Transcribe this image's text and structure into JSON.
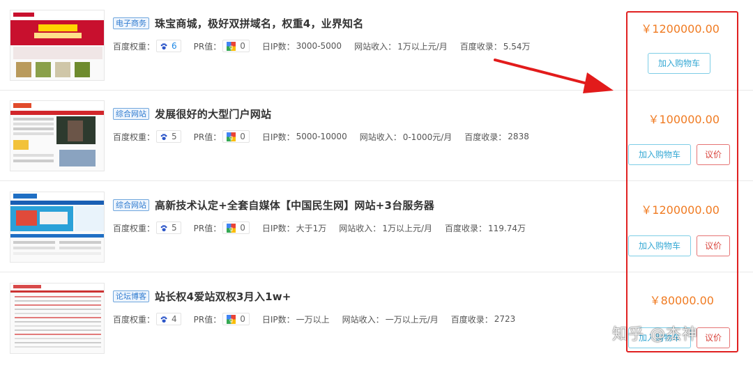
{
  "listings": [
    {
      "category": "电子商务",
      "title": "珠宝商城，极好双拼域名，权重4，业界知名",
      "baidu_weight_label": "百度权重：",
      "baidu_weight": "6",
      "pr_label": "PR值：",
      "pr": "0",
      "ip_label": "日IP数：",
      "ip": "3000-5000",
      "income_label": "网站收入：",
      "income": "1万以上元/月",
      "index_label": "百度收录：",
      "index": "5.54万",
      "price": "￥1200000.00",
      "cart_label": "加入购物车",
      "negotiate_label": ""
    },
    {
      "category": "综合网站",
      "title": "发展很好的大型门户网站",
      "baidu_weight_label": "百度权重：",
      "baidu_weight": "5",
      "pr_label": "PR值：",
      "pr": "0",
      "ip_label": "日IP数：",
      "ip": "5000-10000",
      "income_label": "网站收入：",
      "income": "0-1000元/月",
      "index_label": "百度收录：",
      "index": "2838",
      "price": "￥100000.00",
      "cart_label": "加入购物车",
      "negotiate_label": "议价"
    },
    {
      "category": "综合网站",
      "title": "高新技术认定+全套自媒体【中国民生网】网站+3台服务器",
      "baidu_weight_label": "百度权重：",
      "baidu_weight": "5",
      "pr_label": "PR值：",
      "pr": "0",
      "ip_label": "日IP数：",
      "ip": "大于1万",
      "income_label": "网站收入：",
      "income": "1万以上元/月",
      "index_label": "百度收录：",
      "index": "119.74万",
      "price": "￥1200000.00",
      "cart_label": "加入购物车",
      "negotiate_label": "议价"
    },
    {
      "category": "论坛博客",
      "title": "站长权4爱站双权3月入1w+",
      "baidu_weight_label": "百度权重：",
      "baidu_weight": "4",
      "pr_label": "PR值：",
      "pr": "0",
      "ip_label": "日IP数：",
      "ip": "一万以上",
      "income_label": "网站收入：",
      "income": "一万以上元/月",
      "index_label": "百度收录：",
      "index": "2723",
      "price": "￥80000.00",
      "cart_label": "加入购物车",
      "negotiate_label": "议价"
    }
  ],
  "watermark": "知乎 @杰神",
  "colors": {
    "price": "#f07b22",
    "highlight": "#e02020",
    "tag_border": "#6fa6dd",
    "cart_border": "#7dcde6",
    "negotiate_border": "#e57373"
  }
}
